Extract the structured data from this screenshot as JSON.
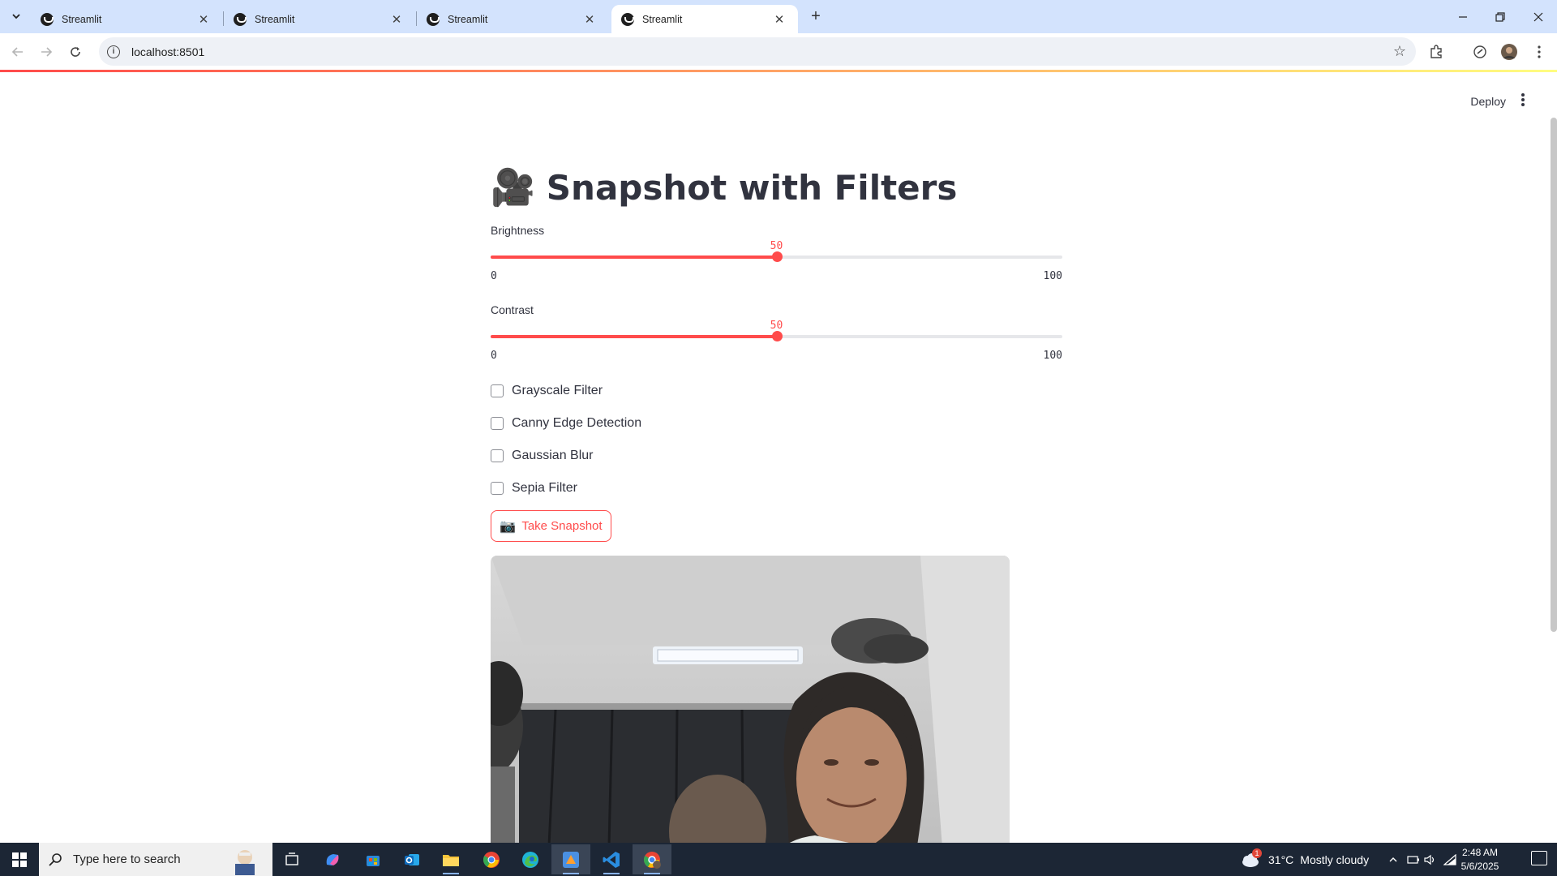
{
  "browser": {
    "tabs": [
      {
        "title": "Streamlit",
        "active": false
      },
      {
        "title": "Streamlit",
        "active": false
      },
      {
        "title": "Streamlit",
        "active": false
      },
      {
        "title": "Streamlit",
        "active": true
      }
    ],
    "url": "localhost:8501"
  },
  "app": {
    "deploy_label": "Deploy",
    "title_emoji": "🎥",
    "title": "Snapshot with Filters",
    "sliders": [
      {
        "label": "Brightness",
        "value": "50",
        "min": "0",
        "max": "100",
        "fraction": 0.5
      },
      {
        "label": "Contrast",
        "value": "50",
        "min": "0",
        "max": "100",
        "fraction": 0.5
      }
    ],
    "checkboxes": [
      {
        "label": "Grayscale Filter",
        "checked": false
      },
      {
        "label": "Canny Edge Detection",
        "checked": false
      },
      {
        "label": "Gaussian Blur",
        "checked": false
      },
      {
        "label": "Sepia Filter",
        "checked": false
      }
    ],
    "snapshot_button": {
      "icon": "📷",
      "label": "Take Snapshot"
    },
    "accent_color": "#ff4b4b"
  },
  "taskbar": {
    "search_placeholder": "Type here to search",
    "weather_temp": "31°C",
    "weather_text": "Mostly cloudy",
    "weather_badge": "1",
    "time": "2:48 AM",
    "date": "5/6/2025"
  }
}
